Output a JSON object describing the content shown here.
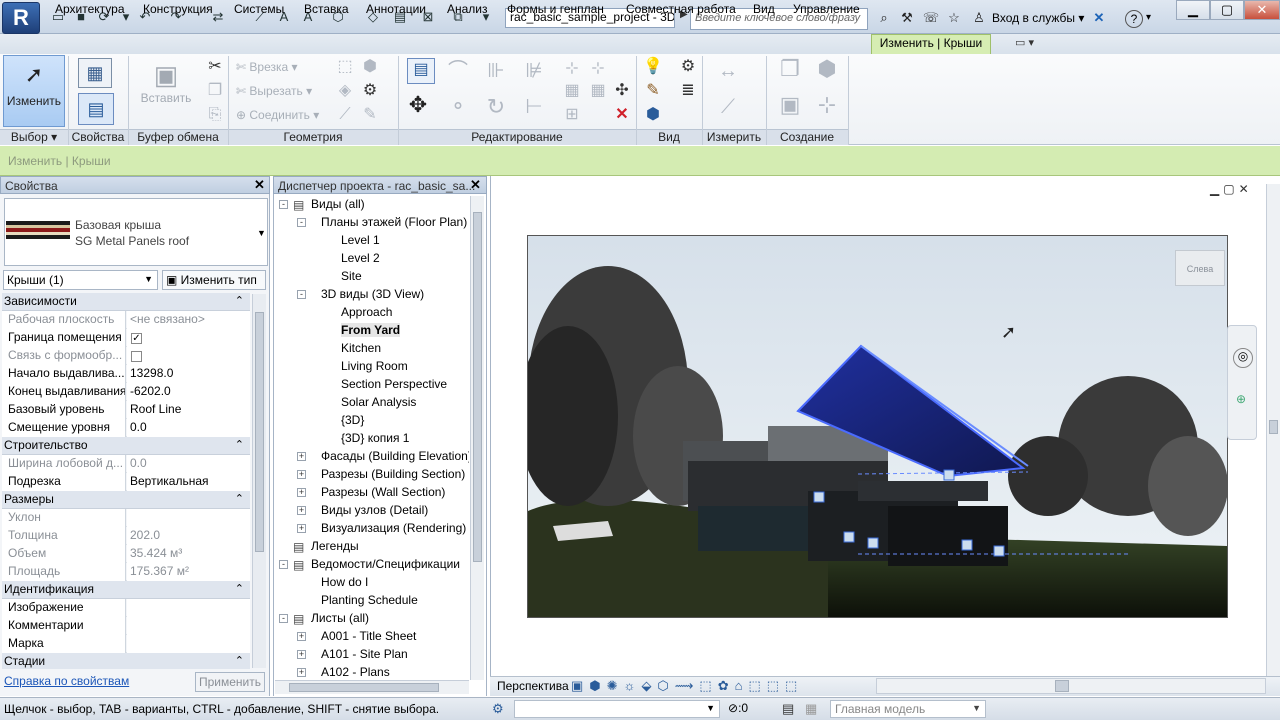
{
  "title_bar": {
    "app_letter": "R",
    "doc_title": "rac_basic_sample_project - 3D ...",
    "search_placeholder": "Введите ключевое слово/фразу",
    "sign_in": "Вход в службы",
    "help": "?"
  },
  "ribbon_tabs": [
    "Архитектура",
    "Конструкция",
    "Системы",
    "Вставка",
    "Аннотации",
    "Анализ",
    "Формы и генплан",
    "Совместная работа",
    "Вид",
    "Управление"
  ],
  "active_tab": "Изменить | Крыши",
  "ribbon": {
    "modify_label": "Изменить",
    "paste_label": "Вставить",
    "cut_label": "Врезка",
    "uncut_label": "Вырезать",
    "join_label": "Соединить",
    "panels": [
      "Выбор",
      "Свойства",
      "Буфер обмена",
      "Геометрия",
      "Редактирование",
      "Вид",
      "Измерить",
      "Создание"
    ]
  },
  "context_bar": {
    "text": "Изменить | Крыши"
  },
  "properties": {
    "title": "Свойства",
    "type_line1": "Базовая крыша",
    "type_line2": "SG Metal Panels roof",
    "selector": "Крыши (1)",
    "edit_type": "Изменить тип",
    "groups": [
      {
        "name": "Зависимости",
        "rows": [
          {
            "k": "Рабочая плоскость",
            "v": "<не связано>",
            "dim": true
          },
          {
            "k": "Граница помещения",
            "v": "✓",
            "dim": false
          },
          {
            "k": "Связь с формообр...",
            "v": "",
            "dim": true
          },
          {
            "k": "Начало выдавлива...",
            "v": "13298.0",
            "dim": false
          },
          {
            "k": "Конец выдавливания",
            "v": "-6202.0",
            "dim": false
          },
          {
            "k": "Базовый уровень",
            "v": "Roof Line",
            "dim": false
          },
          {
            "k": "Смещение уровня",
            "v": "0.0",
            "dim": false
          }
        ]
      },
      {
        "name": "Строительство",
        "rows": [
          {
            "k": "Ширина лобовой д...",
            "v": "0.0",
            "dim": true
          },
          {
            "k": "Подрезка",
            "v": "Вертикальная",
            "dim": false
          }
        ]
      },
      {
        "name": "Размеры",
        "rows": [
          {
            "k": "Уклон",
            "v": "",
            "dim": true
          },
          {
            "k": "Толщина",
            "v": "202.0",
            "dim": true
          },
          {
            "k": "Объем",
            "v": "35.424 м³",
            "dim": true
          },
          {
            "k": "Площадь",
            "v": "175.367 м²",
            "dim": true
          }
        ]
      },
      {
        "name": "Идентификация",
        "rows": [
          {
            "k": "Изображение",
            "v": "",
            "dim": false
          },
          {
            "k": "Комментарии",
            "v": "",
            "dim": false
          },
          {
            "k": "Марка",
            "v": "",
            "dim": false
          }
        ]
      },
      {
        "name": "Стадии",
        "rows": []
      }
    ],
    "help_link": "Справка по свойствам",
    "apply": "Применить"
  },
  "browser": {
    "title": "Диспетчер проекта - rac_basic_sa...",
    "items": [
      {
        "label": "Виды (all)",
        "level": 0,
        "toggle": "-",
        "bold": false
      },
      {
        "label": "Планы этажей (Floor Plan)",
        "level": 1,
        "toggle": "-",
        "bold": false
      },
      {
        "label": "Level 1",
        "level": 2,
        "toggle": "",
        "bold": false
      },
      {
        "label": "Level 2",
        "level": 2,
        "toggle": "",
        "bold": false
      },
      {
        "label": "Site",
        "level": 2,
        "toggle": "",
        "bold": false
      },
      {
        "label": "3D виды (3D View)",
        "level": 1,
        "toggle": "-",
        "bold": false
      },
      {
        "label": "Approach",
        "level": 2,
        "toggle": "",
        "bold": false
      },
      {
        "label": "From Yard",
        "level": 2,
        "toggle": "",
        "bold": true
      },
      {
        "label": "Kitchen",
        "level": 2,
        "toggle": "",
        "bold": false
      },
      {
        "label": "Living Room",
        "level": 2,
        "toggle": "",
        "bold": false
      },
      {
        "label": "Section Perspective",
        "level": 2,
        "toggle": "",
        "bold": false
      },
      {
        "label": "Solar Analysis",
        "level": 2,
        "toggle": "",
        "bold": false
      },
      {
        "label": "{3D}",
        "level": 2,
        "toggle": "",
        "bold": false
      },
      {
        "label": "{3D} копия 1",
        "level": 2,
        "toggle": "",
        "bold": false
      },
      {
        "label": "Фасады (Building Elevation)",
        "level": 1,
        "toggle": "+",
        "bold": false
      },
      {
        "label": "Разрезы (Building Section)",
        "level": 1,
        "toggle": "+",
        "bold": false
      },
      {
        "label": "Разрезы (Wall Section)",
        "level": 1,
        "toggle": "+",
        "bold": false
      },
      {
        "label": "Виды узлов (Detail)",
        "level": 1,
        "toggle": "+",
        "bold": false
      },
      {
        "label": "Визуализация (Rendering)",
        "level": 1,
        "toggle": "+",
        "bold": false
      },
      {
        "label": "Легенды",
        "level": 0,
        "toggle": "",
        "bold": false
      },
      {
        "label": "Ведомости/Спецификации",
        "level": 0,
        "toggle": "-",
        "bold": false
      },
      {
        "label": "How do I",
        "level": 1,
        "toggle": "",
        "bold": false
      },
      {
        "label": "Planting Schedule",
        "level": 1,
        "toggle": "",
        "bold": false
      },
      {
        "label": "Листы (all)",
        "level": 0,
        "toggle": "-",
        "bold": false
      },
      {
        "label": "A001 - Title Sheet",
        "level": 1,
        "toggle": "+",
        "bold": false
      },
      {
        "label": "A101 - Site Plan",
        "level": 1,
        "toggle": "+",
        "bold": false
      },
      {
        "label": "A102 - Plans",
        "level": 1,
        "toggle": "+",
        "bold": false
      }
    ]
  },
  "viewcube": {
    "left": "Слева"
  },
  "view_bar": {
    "mode": "Перспектива"
  },
  "status": {
    "hint": "Щелчок - выбор, TAB - варианты, CTRL - добавление, SHIFT - снятие выбора.",
    "filter": ":0",
    "model": "Главная модель"
  },
  "colors": {
    "context_green": "#d4ecb2",
    "selected_roof": "#2233aa",
    "sky": "#dfe7ee"
  }
}
